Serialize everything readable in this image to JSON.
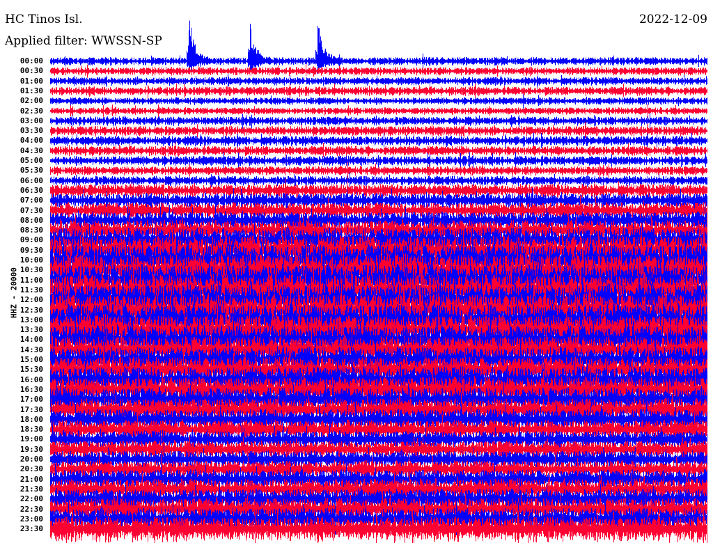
{
  "header": {
    "station": "HC Tinos Isl.",
    "filter": "Applied filter: WWSSN-SP",
    "date": "2022-12-09"
  },
  "chart_data": {
    "type": "line",
    "title": "HC Tinos Isl.",
    "subtitle": "Applied filter: WWSSN-SP",
    "date": "2022-12-09",
    "ylabel": "HHZ - 20000",
    "xlabel": "",
    "row_labels": [
      "00:00",
      "00:30",
      "01:00",
      "01:30",
      "02:00",
      "02:30",
      "03:00",
      "03:30",
      "04:00",
      "04:30",
      "05:00",
      "05:30",
      "06:00",
      "06:30",
      "07:00",
      "07:30",
      "08:00",
      "08:30",
      "09:00",
      "09:30",
      "10:00",
      "10:30",
      "11:00",
      "11:30",
      "12:00",
      "12:30",
      "13:00",
      "13:30",
      "14:00",
      "14:30",
      "15:00",
      "15:30",
      "16:00",
      "16:30",
      "17:00",
      "17:30",
      "18:00",
      "18:30",
      "19:00",
      "19:30",
      "20:00",
      "20:30",
      "21:00",
      "21:30",
      "22:00",
      "22:30",
      "23:00",
      "23:30"
    ],
    "trace_colors": [
      "#0000ff",
      "#ff0033"
    ],
    "relative_amplitude": [
      0.5,
      0.5,
      0.5,
      0.55,
      0.45,
      0.45,
      0.55,
      0.6,
      0.6,
      0.6,
      0.6,
      0.55,
      0.6,
      0.8,
      0.9,
      1,
      1.1,
      1.3,
      1.6,
      1.8,
      2,
      2,
      2,
      2,
      2,
      2,
      2,
      1.9,
      1.8,
      1.7,
      1.6,
      1.6,
      1.6,
      1.6,
      1.5,
      1.4,
      1.3,
      1.2,
      1.1,
      1.1,
      1.1,
      1.1,
      1.2,
      1.3,
      1.3,
      1.4,
      1.4,
      1.5
    ],
    "events": [
      {
        "row": "00:00",
        "position_minutes": 6.3,
        "relative_amplitude": 6
      },
      {
        "row": "00:00",
        "position_minutes": 9.1,
        "relative_amplitude": 5
      },
      {
        "row": "00:00",
        "position_minutes": 12.2,
        "relative_amplitude": 5
      }
    ],
    "minutes_per_row": 30
  }
}
